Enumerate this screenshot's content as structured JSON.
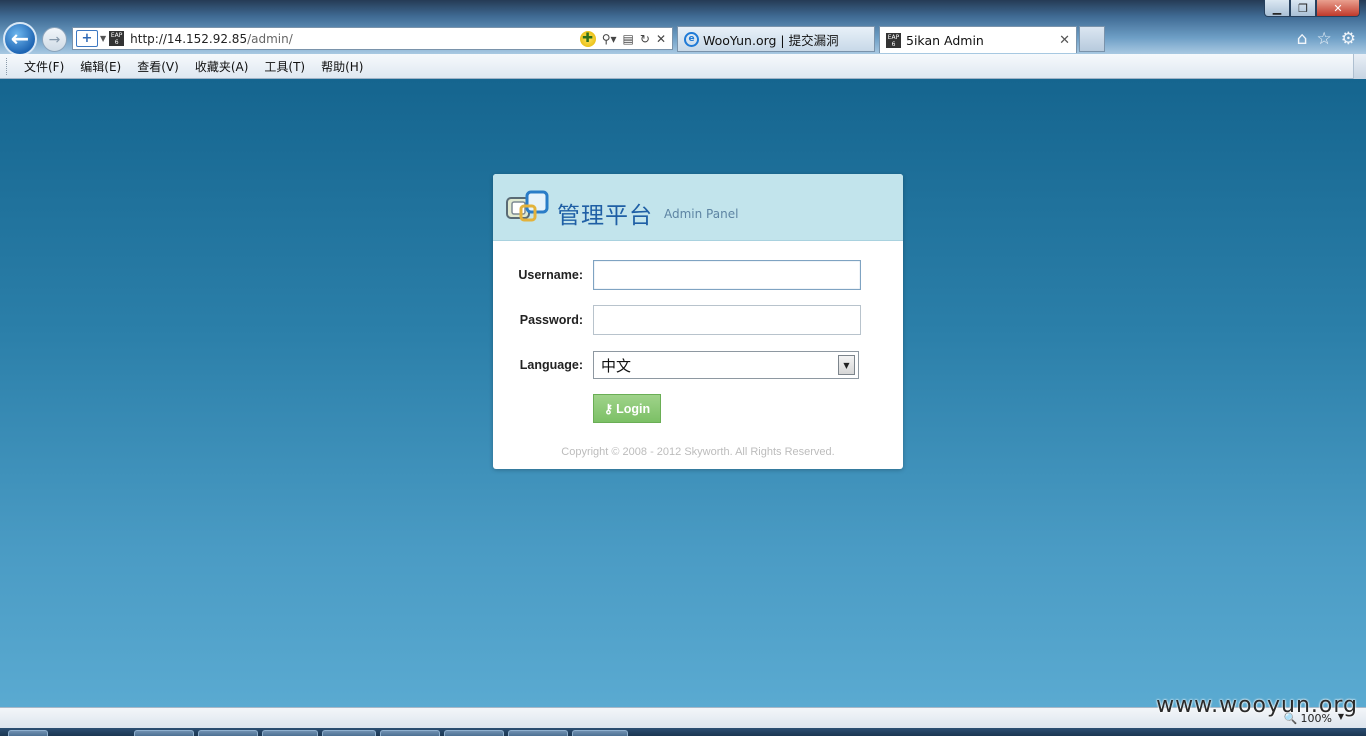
{
  "browser": {
    "url_host": "http://14.152.92.85",
    "url_path": "/admin/",
    "tabs": [
      {
        "title": "WooYun.org | 提交漏洞",
        "icon": "ie-icon"
      },
      {
        "title": "5ikan Admin",
        "icon": "eap-icon",
        "active": true
      }
    ],
    "menu": [
      "文件(F)",
      "编辑(E)",
      "查看(V)",
      "收藏夹(A)",
      "工具(T)",
      "帮助(H)"
    ],
    "eap_label": "EAP 6",
    "window_controls": {
      "minimize": "▁",
      "maximize": "❐",
      "close": "✕"
    }
  },
  "panel": {
    "title": "管理平台",
    "subtitle": "Admin Panel",
    "username_label": "Username:",
    "username_value": "",
    "password_label": "Password:",
    "password_value": "",
    "language_label": "Language:",
    "language_value": "中文",
    "login_label": "Login",
    "copyright": "Copyright © 2008 - 2012 Skyworth. All Rights Reserved."
  },
  "statusbar": {
    "zoom": "100%"
  },
  "watermark": "www.wooyun.org",
  "colors": {
    "page_bg_top": "#15658f",
    "page_bg_bottom": "#5aaad1",
    "panel_header": "#c2e4ec",
    "title_blue": "#1f5fa5",
    "login_green": "#8cc977"
  }
}
